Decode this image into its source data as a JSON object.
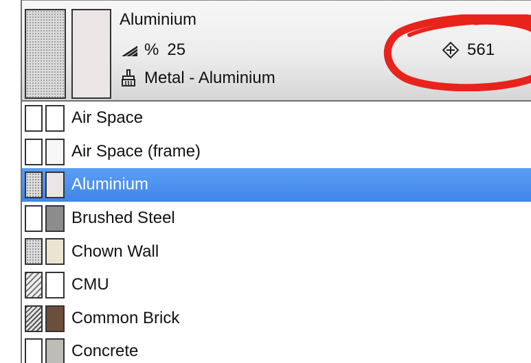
{
  "header": {
    "title": "Aluminium",
    "transparency_symbol": "%",
    "transparency_value": "25",
    "material_label": "Metal - Aluminium",
    "index_value": "561",
    "surface_color": "#ece5e5",
    "annotation_color": "#e8231c"
  },
  "list": {
    "items": [
      {
        "label": "Air Space",
        "fill_pattern": "solid",
        "fill_color": "#ffffff",
        "surface_color": "#ffffff",
        "selected": false
      },
      {
        "label": "Air Space (frame)",
        "fill_pattern": "solid",
        "fill_color": "#ffffff",
        "surface_color": "#f7f7f7",
        "selected": false
      },
      {
        "label": "Aluminium",
        "fill_pattern": "dots",
        "fill_color": "#dedede",
        "surface_color": "#ece5e5",
        "selected": true
      },
      {
        "label": "Brushed Steel",
        "fill_pattern": "solid",
        "fill_color": "#ffffff",
        "surface_color": "#8c8c8c",
        "selected": false
      },
      {
        "label": "Chown Wall",
        "fill_pattern": "dots",
        "fill_color": "#dedede",
        "surface_color": "#ece4d2",
        "selected": false
      },
      {
        "label": "CMU",
        "fill_pattern": "hatch",
        "fill_color": "#f0f0f0",
        "surface_color": "#ffffff",
        "selected": false
      },
      {
        "label": "Common Brick",
        "fill_pattern": "hatch-dark",
        "fill_color": "#e6e6e6",
        "surface_color": "#6b4e3c",
        "selected": false
      },
      {
        "label": "Concrete",
        "fill_pattern": "solid",
        "fill_color": "#ffffff",
        "surface_color": "#bdbdb5",
        "selected": false
      }
    ],
    "selected_color": "#4a90ee"
  }
}
